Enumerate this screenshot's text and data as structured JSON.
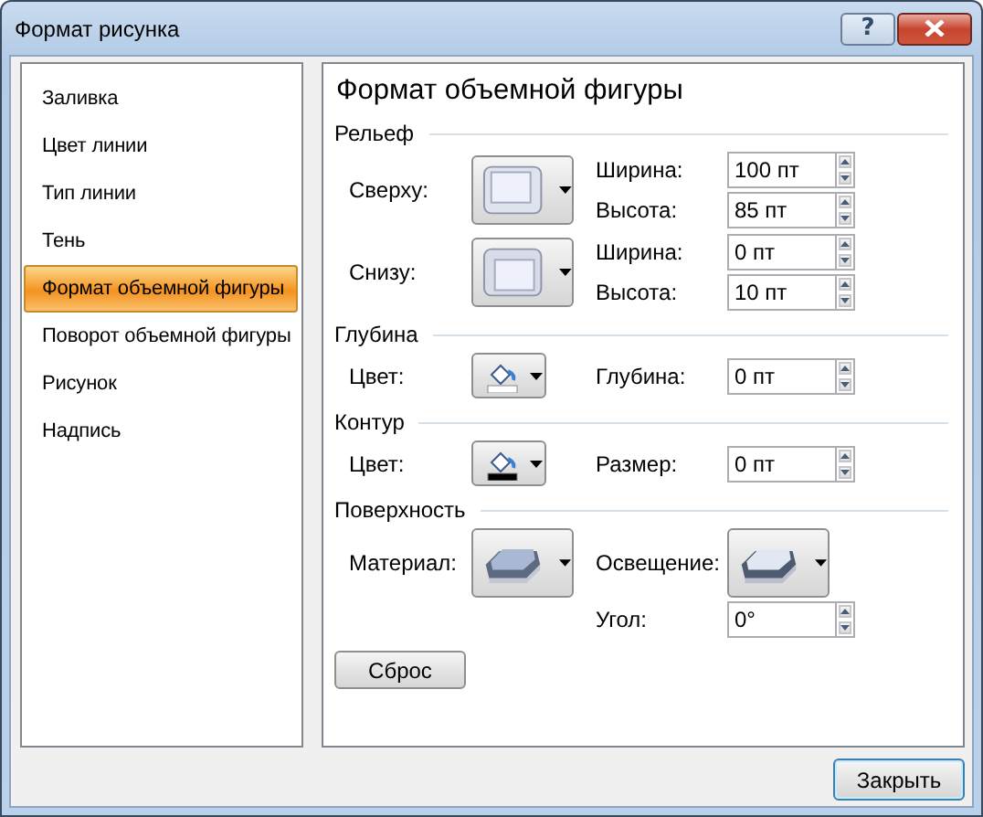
{
  "window": {
    "title": "Формат рисунка",
    "help_button": "?"
  },
  "sidebar": {
    "items": [
      {
        "label": "Заливка",
        "selected": false
      },
      {
        "label": "Цвет линии",
        "selected": false
      },
      {
        "label": "Тип линии",
        "selected": false
      },
      {
        "label": "Тень",
        "selected": false
      },
      {
        "label": "Формат объемной фигуры",
        "selected": true
      },
      {
        "label": "Поворот объемной фигуры",
        "selected": false
      },
      {
        "label": "Рисунок",
        "selected": false
      },
      {
        "label": "Надпись",
        "selected": false
      }
    ]
  },
  "panel": {
    "title": "Формат объемной фигуры",
    "sections": [
      {
        "title": "Рельеф",
        "rows": [
          {
            "label": "Сверху:",
            "control": {
              "kind": "bevel-top"
            },
            "fields": [
              {
                "kind": "spin",
                "label": "Ширина:",
                "value": "100 пт"
              },
              {
                "kind": "spin",
                "label": "Высота:",
                "value": "85 пт"
              }
            ]
          },
          {
            "label": "Снизу:",
            "control": {
              "kind": "bevel-bottom"
            },
            "fields": [
              {
                "kind": "spin",
                "label": "Ширина:",
                "value": "0 пт"
              },
              {
                "kind": "spin",
                "label": "Высота:",
                "value": "10 пт"
              }
            ]
          }
        ]
      },
      {
        "title": "Глубина",
        "rows": [
          {
            "label": "Цвет:",
            "control": {
              "kind": "color",
              "color": "#ffffff"
            },
            "fields": [
              {
                "kind": "spin",
                "label": "Глубина:",
                "value": "0 пт"
              }
            ]
          }
        ]
      },
      {
        "title": "Контур",
        "rows": [
          {
            "label": "Цвет:",
            "control": {
              "kind": "color",
              "color": "#000000"
            },
            "fields": [
              {
                "kind": "spin",
                "label": "Размер:",
                "value": "0 пт"
              }
            ]
          }
        ]
      },
      {
        "title": "Поверхность",
        "rows": [
          {
            "label": "Материал:",
            "control": {
              "kind": "material"
            },
            "fields": [
              {
                "kind": "picker",
                "label": "Освещение:",
                "control": {
                  "kind": "lighting"
                }
              },
              {
                "kind": "spin",
                "label": "Угол:",
                "value": "0°"
              }
            ]
          }
        ]
      }
    ],
    "reset_button": "Сброс"
  },
  "footer": {
    "close_button": "Закрыть"
  }
}
